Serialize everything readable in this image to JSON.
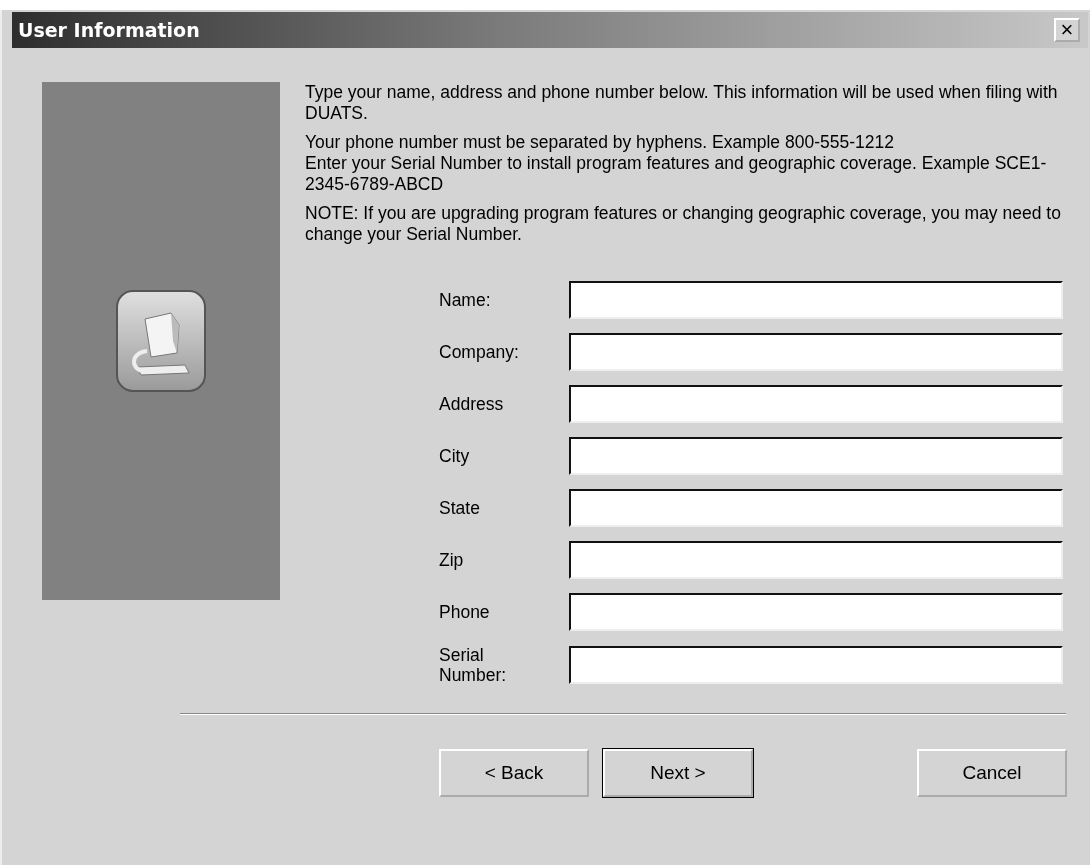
{
  "window": {
    "title": "User Information",
    "close_button": "×"
  },
  "instructions": [
    [
      "Type your name, address and phone number below. This information will be used when filing with DUATS."
    ],
    [
      "Your phone number must be separated by hyphens. Example 800-555-1212",
      "Enter your Serial Number to install program features and geographic coverage. Example SCE1-2345-6789-ABCD"
    ],
    [
      "NOTE: If you are upgrading program features or changing geographic coverage, you may need to change your Serial Number."
    ]
  ],
  "fields": [
    {
      "label": "Name:"
    },
    {
      "label": "Company:"
    },
    {
      "label": "Address"
    },
    {
      "label": "City"
    },
    {
      "label": "State"
    },
    {
      "label": "Zip"
    },
    {
      "label": "Phone"
    },
    {
      "label": "Serial Number:"
    }
  ],
  "buttons": [
    {
      "label": "< Back",
      "default": false
    },
    {
      "label": "Next >",
      "default": true
    },
    {
      "label": "Cancel",
      "default": false
    }
  ]
}
